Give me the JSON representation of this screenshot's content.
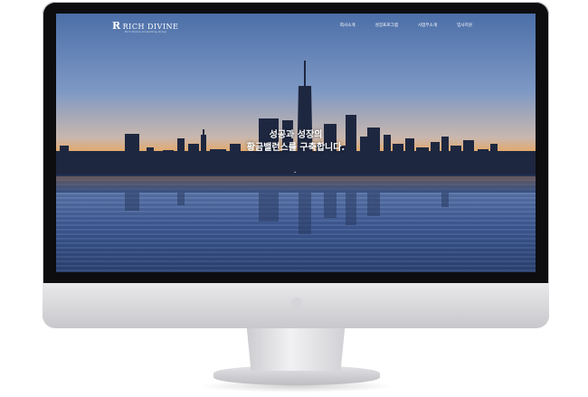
{
  "header": {
    "logo_mark": "R",
    "logo_text": "RICH DIVINE",
    "logo_tagline": "Rich Divine Consulting Group"
  },
  "nav": {
    "items": [
      {
        "label": "회사소개"
      },
      {
        "label": "성장프로그램"
      },
      {
        "label": "사업부소개"
      },
      {
        "label": "입사지원"
      }
    ]
  },
  "hero": {
    "line1": "성공과 성장의",
    "line2": "황금밸런스를 구축합니다.",
    "scroll_glyph": "⌄"
  },
  "colors": {
    "sky_top": "#4c6fa8",
    "sunset": "#f0a24a",
    "water": "#2e4676",
    "bezel": "#0d0d0f"
  }
}
